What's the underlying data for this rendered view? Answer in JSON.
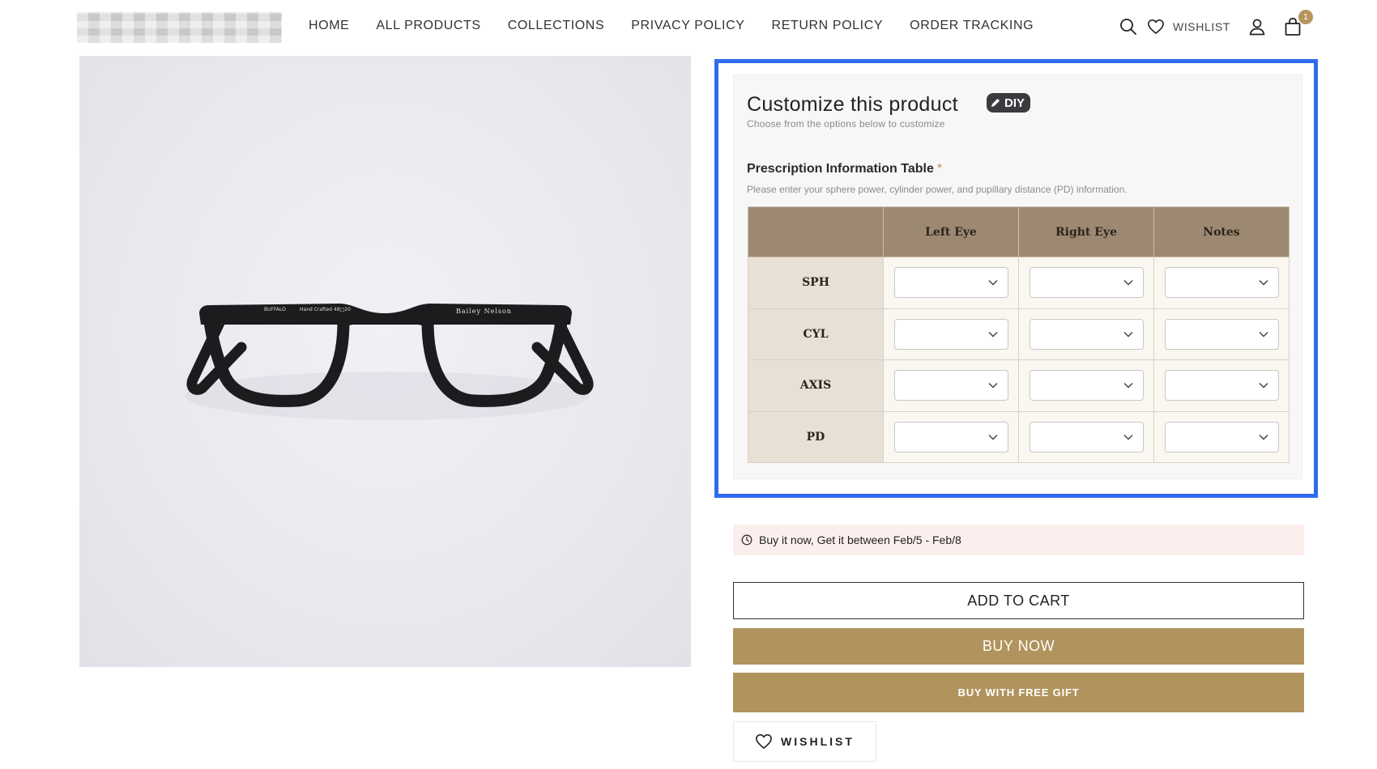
{
  "header": {
    "nav": [
      {
        "label": "HOME"
      },
      {
        "label": "ALL PRODUCTS"
      },
      {
        "label": "COLLECTIONS"
      },
      {
        "label": "PRIVACY POLICY"
      },
      {
        "label": "RETURN POLICY"
      },
      {
        "label": "ORDER TRACKING"
      }
    ],
    "wishlist_label": "WISHLIST",
    "cart_count": "1",
    "icons": [
      "search-icon",
      "heart-icon",
      "user-icon",
      "bag-icon"
    ]
  },
  "product": {
    "image_alt": "black eyeglasses",
    "frame_texts": {
      "left_temple": "BUFFALO",
      "middle": "Hand Crafted",
      "size": "48□20",
      "brand": "Bailey Nelson"
    }
  },
  "customize": {
    "title": "Customize this product",
    "badge": "DIY",
    "subtitle": "Choose from the options below to customize",
    "rx_title": "Prescription Information Table",
    "required_mark": "*",
    "rx_description": "Please enter your sphere power, cylinder power, and pupillary distance (PD) information.",
    "columns": [
      "",
      "Left Eye",
      "Right Eye",
      "Notes"
    ],
    "rows": [
      {
        "label": "SPH"
      },
      {
        "label": "CYL"
      },
      {
        "label": "AXIS"
      },
      {
        "label": "PD"
      }
    ]
  },
  "delivery": {
    "text": "Buy it now, Get it between Feb/5 - Feb/8"
  },
  "buttons": {
    "add_to_cart": "ADD TO CART",
    "buy_now": "BUY NOW",
    "buy_with_gift": "BUY WITH FREE GIFT",
    "wishlist": "WISHLIST"
  },
  "colors": {
    "accent_gold": "#b0935d",
    "table_header": "#9d8872",
    "focus_outline": "#2f6bef",
    "delivery_bg": "#fdeeee"
  }
}
